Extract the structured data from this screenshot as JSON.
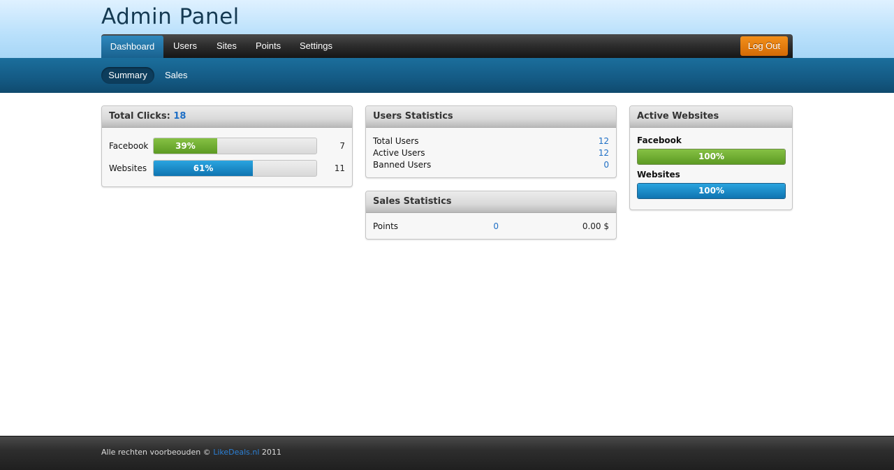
{
  "header": {
    "title": "Admin Panel"
  },
  "nav": {
    "tabs": [
      {
        "label": "Dashboard",
        "active": true
      },
      {
        "label": "Users"
      },
      {
        "label": "Sites"
      },
      {
        "label": "Points"
      },
      {
        "label": "Settings"
      }
    ],
    "logout_label": "Log Out"
  },
  "subnav": {
    "tabs": [
      {
        "label": "Summary",
        "active": true
      },
      {
        "label": "Sales"
      }
    ]
  },
  "clicks": {
    "title": "Total Clicks:",
    "total": "18",
    "rows": [
      {
        "label": "Facebook",
        "percent_label": "39%",
        "fraction": 0.39,
        "count": "7",
        "color": "#5c9a23"
      },
      {
        "label": "Websites",
        "percent_label": "61%",
        "fraction": 0.61,
        "count": "11",
        "color": "#0f74b1"
      }
    ]
  },
  "users_stats": {
    "title": "Users Statistics",
    "rows": [
      {
        "label": "Total Users",
        "value": "12"
      },
      {
        "label": "Active Users",
        "value": "12"
      },
      {
        "label": "Banned Users",
        "value": "0"
      }
    ]
  },
  "sales_stats": {
    "title": "Sales Statistics",
    "label": "Points",
    "count": "0",
    "amount": "0.00 $"
  },
  "active_sites": {
    "title": "Active Websites",
    "items": [
      {
        "label": "Facebook",
        "percent_label": "100%",
        "fraction": 1.0,
        "color": "#5c9a23"
      },
      {
        "label": "Websites",
        "percent_label": "100%",
        "fraction": 1.0,
        "color": "#0f74b1"
      }
    ]
  },
  "footer": {
    "text_before": "Alle rechten voorbeouden ©",
    "link": "LikeDeals.nl",
    "year": "2011"
  },
  "colors": {
    "accent": "#1f6fc5",
    "logout": "#e07a0c",
    "header_bg": "#b9e0fb",
    "subnav_bg": "#145a84"
  }
}
